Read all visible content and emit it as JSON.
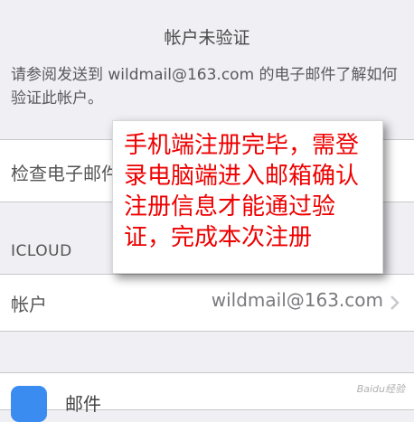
{
  "verification": {
    "title": "帐户未验证",
    "description": "请参阅发送到 wildmail@163.com 的电子邮件了解如何验证此帐户。"
  },
  "check_email": {
    "label": "检查电子邮件"
  },
  "icloud": {
    "header": "ICLOUD",
    "account_label": "帐户",
    "account_value": "wildmail@163.com"
  },
  "bottom_row": {
    "label": "邮件"
  },
  "annotation": {
    "text": "手机端注册完毕，需登录电脑端进入邮箱确认注册信息才能通过验证，完成本次注册",
    "color": "#ee0000"
  },
  "watermark": "Baidu经验"
}
